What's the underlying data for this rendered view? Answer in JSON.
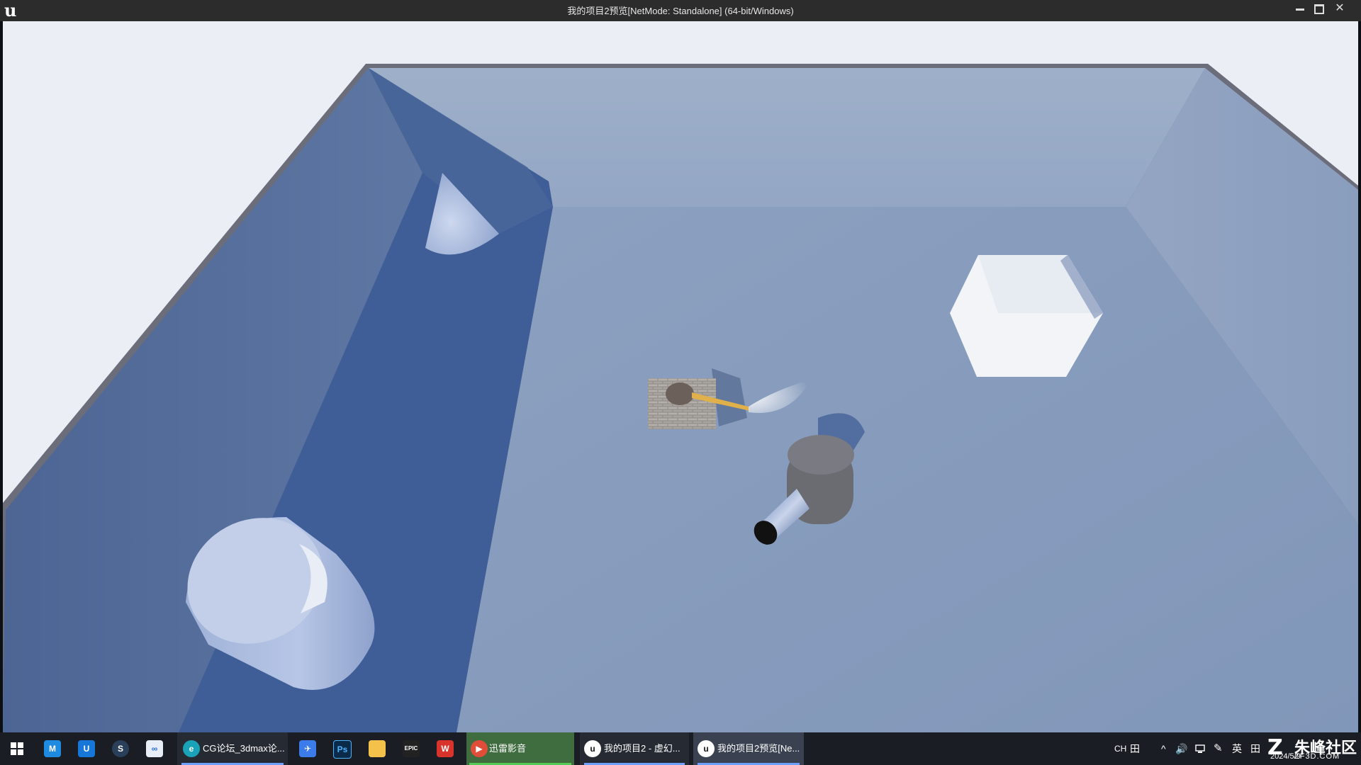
{
  "window": {
    "title": "我的项目2预览[NetMode: Standalone]  (64-bit/Windows)",
    "logo_glyph": "u",
    "controls": [
      "minimize-icon",
      "maximize-icon",
      "close-icon"
    ],
    "close_glyph": "✕"
  },
  "scene": {
    "objects": [
      "cone",
      "cube",
      "cylinder",
      "player-tank",
      "turret-cannon"
    ]
  },
  "taskbar": {
    "items": [
      {
        "name": "start-button",
        "icon": "windows-icon",
        "label": ""
      },
      {
        "name": "app-maya",
        "icon": "maya-icon",
        "glyph": "M",
        "label": ""
      },
      {
        "name": "app-u-tool",
        "icon": "u-app-icon",
        "glyph": "U",
        "label": ""
      },
      {
        "name": "app-steam",
        "icon": "steam-icon",
        "glyph": "S",
        "label": ""
      },
      {
        "name": "app-teams",
        "icon": "baidu-netdisk-icon",
        "glyph": "∞",
        "label": ""
      },
      {
        "name": "app-edge",
        "icon": "edge-icon",
        "glyph": "e",
        "label": "CG论坛_3dmax论..."
      },
      {
        "name": "app-feishu",
        "icon": "feishu-icon",
        "glyph": "✈",
        "label": ""
      },
      {
        "name": "app-photoshop",
        "icon": "photoshop-icon",
        "glyph": "Ps",
        "label": ""
      },
      {
        "name": "app-explorer",
        "icon": "folder-icon",
        "glyph": "",
        "label": ""
      },
      {
        "name": "app-epic",
        "icon": "epic-games-icon",
        "glyph": "EPIC",
        "label": ""
      },
      {
        "name": "app-wps",
        "icon": "wps-icon",
        "glyph": "W",
        "label": ""
      },
      {
        "name": "app-xunlei",
        "icon": "xunlei-player-icon",
        "glyph": "▶",
        "label": "迅雷影音"
      },
      {
        "name": "app-unreal-editor",
        "icon": "unreal-icon",
        "glyph": "u",
        "label": "我的项目2 - 虚幻..."
      },
      {
        "name": "app-unreal-preview",
        "icon": "unreal-icon",
        "glyph": "u",
        "label": "我的项目2预览[Ne..."
      }
    ],
    "tray": {
      "lang_code": "CH",
      "ime_mode": "英",
      "grid_glyph": "田",
      "chevron": "^",
      "volume": "🔊",
      "pen": "✎"
    }
  },
  "watermark": {
    "title": "朱峰社区",
    "subtitle": "ZF3D.COM",
    "date": "2024/5/9"
  },
  "colors": {
    "floor": "#8fa2c2",
    "wall_dark": "#3c5a93",
    "wall_side": "#5a72a0",
    "back_wall": "#9fb0c8",
    "rim": "#6a6d78",
    "taskbar": "#1a1d24",
    "titlebar": "#2c2c2c"
  }
}
